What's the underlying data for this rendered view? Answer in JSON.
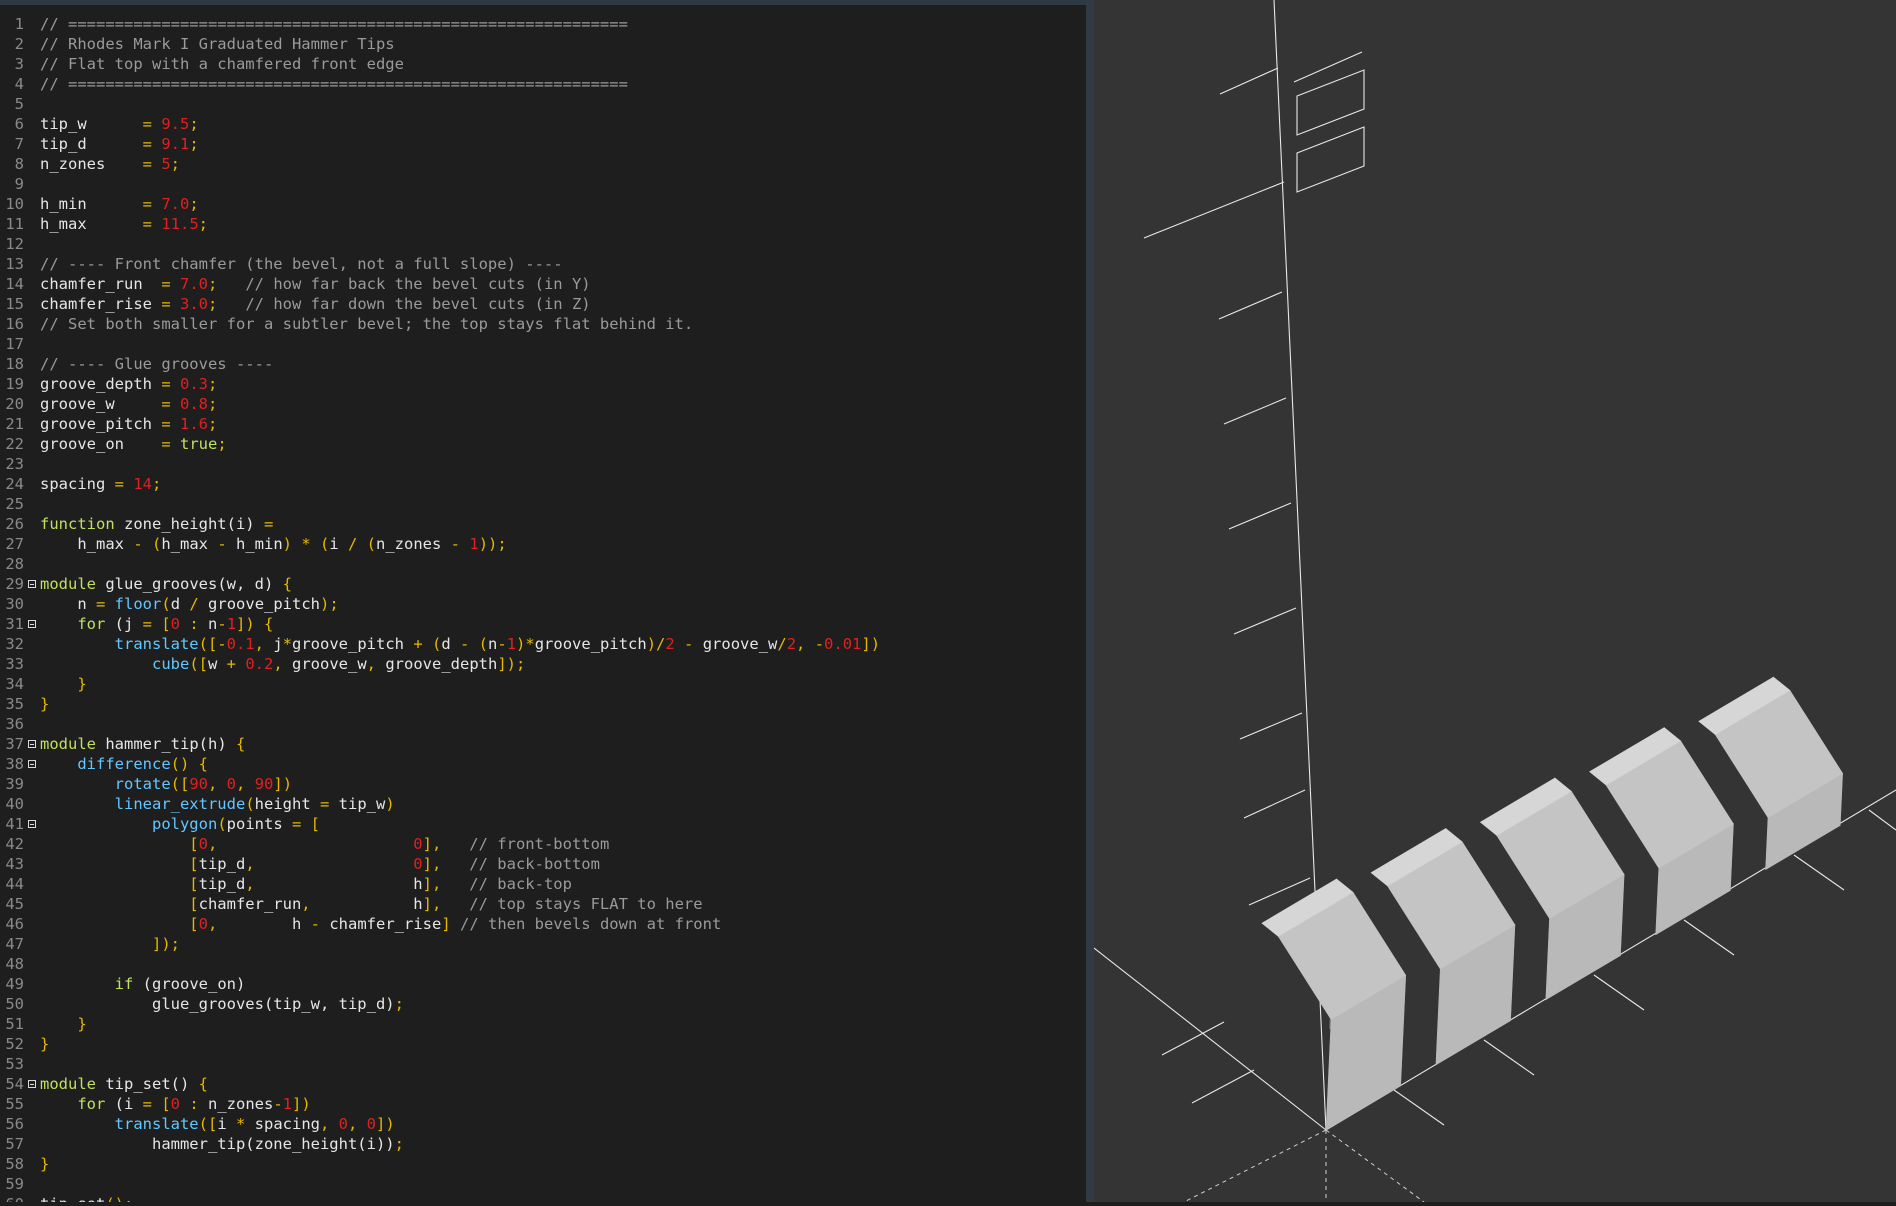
{
  "editor": {
    "lines": [
      [
        [
          "c",
          "// ============================================================"
        ]
      ],
      [
        [
          "c",
          "// Rhodes Mark I Graduated Hammer Tips"
        ]
      ],
      [
        [
          "c",
          "// Flat top with a chamfered front edge"
        ]
      ],
      [
        [
          "c",
          "// ============================================================"
        ]
      ],
      [],
      [
        [
          "t",
          "tip_w      "
        ],
        [
          "o",
          "= "
        ],
        [
          "n",
          "9.5"
        ],
        [
          "o",
          ";"
        ]
      ],
      [
        [
          "t",
          "tip_d      "
        ],
        [
          "o",
          "= "
        ],
        [
          "n",
          "9.1"
        ],
        [
          "o",
          ";"
        ]
      ],
      [
        [
          "t",
          "n_zones    "
        ],
        [
          "o",
          "= "
        ],
        [
          "n",
          "5"
        ],
        [
          "o",
          ";"
        ]
      ],
      [],
      [
        [
          "t",
          "h_min      "
        ],
        [
          "o",
          "= "
        ],
        [
          "n",
          "7.0"
        ],
        [
          "o",
          ";"
        ]
      ],
      [
        [
          "t",
          "h_max      "
        ],
        [
          "o",
          "= "
        ],
        [
          "n",
          "11.5"
        ],
        [
          "o",
          ";"
        ]
      ],
      [],
      [
        [
          "c",
          "// ---- Front chamfer (the bevel, not a full slope) ----"
        ]
      ],
      [
        [
          "t",
          "chamfer_run  "
        ],
        [
          "o",
          "= "
        ],
        [
          "n",
          "7.0"
        ],
        [
          "o",
          ";"
        ],
        [
          "c",
          "   // how far back the bevel cuts (in Y)"
        ]
      ],
      [
        [
          "t",
          "chamfer_rise "
        ],
        [
          "o",
          "= "
        ],
        [
          "n",
          "3.0"
        ],
        [
          "o",
          ";"
        ],
        [
          "c",
          "   // how far down the bevel cuts (in Z)"
        ]
      ],
      [
        [
          "c",
          "// Set both smaller for a subtler bevel; the top stays flat behind it."
        ]
      ],
      [],
      [
        [
          "c",
          "// ---- Glue grooves ----"
        ]
      ],
      [
        [
          "t",
          "groove_depth "
        ],
        [
          "o",
          "= "
        ],
        [
          "n",
          "0.3"
        ],
        [
          "o",
          ";"
        ]
      ],
      [
        [
          "t",
          "groove_w     "
        ],
        [
          "o",
          "= "
        ],
        [
          "n",
          "0.8"
        ],
        [
          "o",
          ";"
        ]
      ],
      [
        [
          "t",
          "groove_pitch "
        ],
        [
          "o",
          "= "
        ],
        [
          "n",
          "1.6"
        ],
        [
          "o",
          ";"
        ]
      ],
      [
        [
          "t",
          "groove_on    "
        ],
        [
          "o",
          "= "
        ],
        [
          "k",
          "true"
        ],
        [
          "o",
          ";"
        ]
      ],
      [],
      [
        [
          "t",
          "spacing "
        ],
        [
          "o",
          "= "
        ],
        [
          "n",
          "14"
        ],
        [
          "o",
          ";"
        ]
      ],
      [],
      [
        [
          "k",
          "function"
        ],
        [
          "t",
          " zone_height(i) "
        ],
        [
          "o",
          "="
        ]
      ],
      [
        [
          "t",
          "    h_max "
        ],
        [
          "o",
          "- ("
        ],
        [
          "t",
          "h_max "
        ],
        [
          "o",
          "-"
        ],
        [
          "t",
          " h_min"
        ],
        [
          "o",
          ") * ("
        ],
        [
          "t",
          "i "
        ],
        [
          "o",
          "/ ("
        ],
        [
          "t",
          "n_zones "
        ],
        [
          "o",
          "- "
        ],
        [
          "n",
          "1"
        ],
        [
          "o",
          "));"
        ]
      ],
      [],
      [
        [
          "k",
          "module"
        ],
        [
          "t",
          " glue_grooves(w, d) "
        ],
        [
          "o",
          "{"
        ]
      ],
      [
        [
          "t",
          "    n "
        ],
        [
          "o",
          "= "
        ],
        [
          "b",
          "floor"
        ],
        [
          "o",
          "("
        ],
        [
          "t",
          "d "
        ],
        [
          "o",
          "/ "
        ],
        [
          "t",
          "groove_pitch"
        ],
        [
          "o",
          ");"
        ]
      ],
      [
        [
          "k",
          "    for"
        ],
        [
          "t",
          " (j "
        ],
        [
          "o",
          "= ["
        ],
        [
          "n",
          "0"
        ],
        [
          "o",
          " : "
        ],
        [
          "t",
          "n"
        ],
        [
          "o",
          "-"
        ],
        [
          "n",
          "1"
        ],
        [
          "o",
          "]) {"
        ]
      ],
      [
        [
          "b",
          "        translate"
        ],
        [
          "o",
          "([-"
        ],
        [
          "n",
          "0.1"
        ],
        [
          "o",
          ", "
        ],
        [
          "t",
          "j"
        ],
        [
          "o",
          "*"
        ],
        [
          "t",
          "groove_pitch "
        ],
        [
          "o",
          "+ ("
        ],
        [
          "t",
          "d "
        ],
        [
          "o",
          "- ("
        ],
        [
          "t",
          "n"
        ],
        [
          "o",
          "-"
        ],
        [
          "n",
          "1"
        ],
        [
          "o",
          ")*"
        ],
        [
          "t",
          "groove_pitch"
        ],
        [
          "o",
          ")/"
        ],
        [
          "n",
          "2"
        ],
        [
          "o",
          " - "
        ],
        [
          "t",
          "groove_w"
        ],
        [
          "o",
          "/"
        ],
        [
          "n",
          "2"
        ],
        [
          "o",
          ", -"
        ],
        [
          "n",
          "0.01"
        ],
        [
          "o",
          "])"
        ]
      ],
      [
        [
          "b",
          "            cube"
        ],
        [
          "o",
          "(["
        ],
        [
          "t",
          "w "
        ],
        [
          "o",
          "+ "
        ],
        [
          "n",
          "0.2"
        ],
        [
          "o",
          ", "
        ],
        [
          "t",
          "groove_w"
        ],
        [
          "o",
          ", "
        ],
        [
          "t",
          "groove_depth"
        ],
        [
          "o",
          "]);"
        ]
      ],
      [
        [
          "o",
          "    }"
        ]
      ],
      [
        [
          "o",
          "}"
        ]
      ],
      [],
      [
        [
          "k",
          "module"
        ],
        [
          "t",
          " hammer_tip(h) "
        ],
        [
          "o",
          "{"
        ]
      ],
      [
        [
          "b",
          "    difference"
        ],
        [
          "o",
          "() {"
        ]
      ],
      [
        [
          "b",
          "        rotate"
        ],
        [
          "o",
          "(["
        ],
        [
          "n",
          "90"
        ],
        [
          "o",
          ", "
        ],
        [
          "n",
          "0"
        ],
        [
          "o",
          ", "
        ],
        [
          "n",
          "90"
        ],
        [
          "o",
          "])"
        ]
      ],
      [
        [
          "b",
          "        linear_extrude"
        ],
        [
          "o",
          "("
        ],
        [
          "t",
          "height "
        ],
        [
          "o",
          "= "
        ],
        [
          "t",
          "tip_w"
        ],
        [
          "o",
          ")"
        ]
      ],
      [
        [
          "b",
          "            polygon"
        ],
        [
          "o",
          "("
        ],
        [
          "t",
          "points "
        ],
        [
          "o",
          "= ["
        ]
      ],
      [
        [
          "o",
          "                ["
        ],
        [
          "n",
          "0"
        ],
        [
          "o",
          ",                     "
        ],
        [
          "n",
          "0"
        ],
        [
          "o",
          "],"
        ],
        [
          "c",
          "   // front-bottom"
        ]
      ],
      [
        [
          "o",
          "                ["
        ],
        [
          "t",
          "tip_d"
        ],
        [
          "o",
          ",                 "
        ],
        [
          "n",
          "0"
        ],
        [
          "o",
          "],"
        ],
        [
          "c",
          "   // back-bottom"
        ]
      ],
      [
        [
          "o",
          "                ["
        ],
        [
          "t",
          "tip_d"
        ],
        [
          "o",
          ",                 "
        ],
        [
          "t",
          "h"
        ],
        [
          "o",
          "],"
        ],
        [
          "c",
          "   // back-top"
        ]
      ],
      [
        [
          "o",
          "                ["
        ],
        [
          "t",
          "chamfer_run"
        ],
        [
          "o",
          ",           "
        ],
        [
          "t",
          "h"
        ],
        [
          "o",
          "],"
        ],
        [
          "c",
          "   // top stays FLAT to here"
        ]
      ],
      [
        [
          "o",
          "                ["
        ],
        [
          "n",
          "0"
        ],
        [
          "o",
          ",        "
        ],
        [
          "t",
          "h "
        ],
        [
          "o",
          "- "
        ],
        [
          "t",
          "chamfer_rise"
        ],
        [
          "o",
          "]"
        ],
        [
          "c",
          " // then bevels down at front"
        ]
      ],
      [
        [
          "o",
          "            ]);"
        ]
      ],
      [],
      [
        [
          "k",
          "        if"
        ],
        [
          "t",
          " (groove_on)"
        ]
      ],
      [
        [
          "t",
          "            glue_grooves(tip_w, tip_d)"
        ],
        [
          "o",
          ";"
        ]
      ],
      [
        [
          "o",
          "    }"
        ]
      ],
      [
        [
          "o",
          "}"
        ]
      ],
      [],
      [
        [
          "k",
          "module"
        ],
        [
          "t",
          " tip_set() "
        ],
        [
          "o",
          "{"
        ]
      ],
      [
        [
          "k",
          "    for"
        ],
        [
          "t",
          " (i "
        ],
        [
          "o",
          "= ["
        ],
        [
          "n",
          "0"
        ],
        [
          "o",
          " : "
        ],
        [
          "t",
          "n_zones"
        ],
        [
          "o",
          "-"
        ],
        [
          "n",
          "1"
        ],
        [
          "o",
          "])"
        ]
      ],
      [
        [
          "b",
          "        translate"
        ],
        [
          "o",
          "(["
        ],
        [
          "t",
          "i "
        ],
        [
          "o",
          "* "
        ],
        [
          "t",
          "spacing"
        ],
        [
          "o",
          ", "
        ],
        [
          "n",
          "0"
        ],
        [
          "o",
          ", "
        ],
        [
          "n",
          "0"
        ],
        [
          "o",
          "])"
        ]
      ],
      [
        [
          "t",
          "            hammer_tip(zone_height(i))"
        ],
        [
          "o",
          ";"
        ]
      ],
      [
        [
          "o",
          "}"
        ]
      ],
      [],
      [
        [
          "t",
          "tip_set"
        ],
        [
          "o",
          "();"
        ]
      ]
    ],
    "fold_lines": [
      29,
      31,
      37,
      38,
      41,
      54
    ]
  },
  "viewport": {
    "background": "#343434",
    "blocks": [
      {
        "index": 1,
        "height": 11.5
      },
      {
        "index": 2,
        "height": 10.375
      },
      {
        "index": 3,
        "height": 9.25
      },
      {
        "index": 4,
        "height": 8.125
      },
      {
        "index": 5,
        "height": 7.0
      }
    ]
  }
}
